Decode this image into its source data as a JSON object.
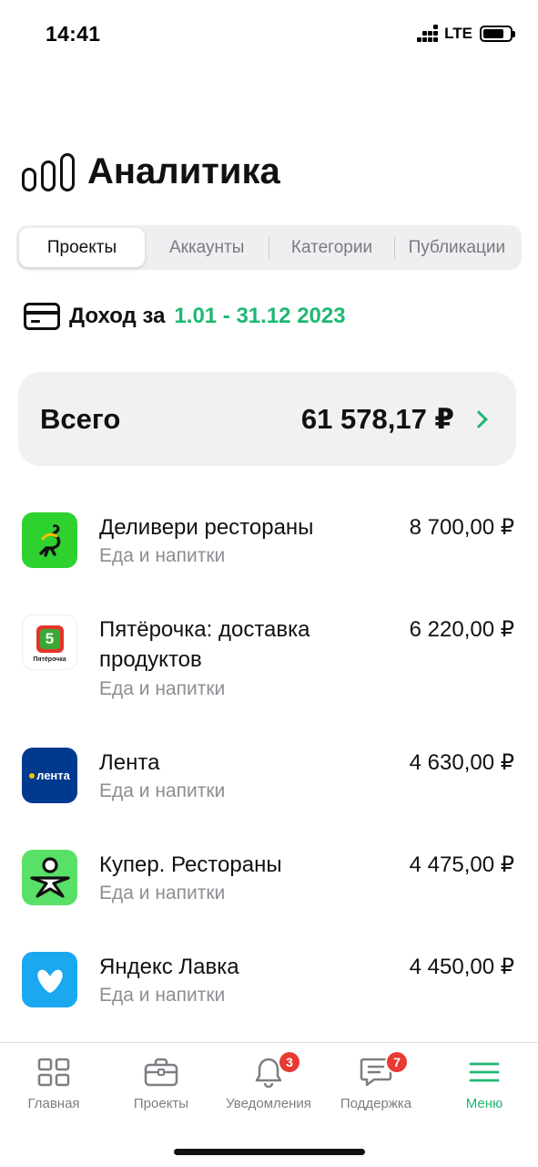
{
  "status": {
    "time": "14:41",
    "network": "LTE"
  },
  "header": {
    "title": "Аналитика",
    "icon": "bar-chart-icon"
  },
  "tabs": [
    {
      "label": "Проекты",
      "active": true
    },
    {
      "label": "Аккаунты",
      "active": false
    },
    {
      "label": "Категории",
      "active": false
    },
    {
      "label": "Публикации",
      "active": false
    }
  ],
  "income": {
    "label": "Доход за",
    "range": "1.01 - 31.12 2023",
    "accent": "#1fb873"
  },
  "total": {
    "label": "Всего",
    "value": "61 578,17 ₽"
  },
  "items": [
    {
      "title": "Деливери рестораны",
      "subtitle": "Еда и напитки",
      "amount": "8 700,00 ₽",
      "icon": "delivery-club-icon"
    },
    {
      "title": "Пятёрочка: доставка продуктов",
      "subtitle": "Еда и напитки",
      "amount": "6 220,00 ₽",
      "icon": "pyaterochka-icon",
      "logo_text": "5",
      "logo_caption": "Пятёрочка"
    },
    {
      "title": "Лента",
      "subtitle": "Еда и напитки",
      "amount": "4 630,00 ₽",
      "icon": "lenta-icon",
      "logo_text": "лента"
    },
    {
      "title": "Купер. Рестораны",
      "subtitle": "Еда и напитки",
      "amount": "4 475,00 ₽",
      "icon": "kuper-icon"
    },
    {
      "title": "Яндекс Лавка",
      "subtitle": "Еда и напитки",
      "amount": "4 450,00 ₽",
      "icon": "yandex-lavka-icon"
    }
  ],
  "tabbar": [
    {
      "label": "Главная",
      "icon": "grid-icon",
      "active": false
    },
    {
      "label": "Проекты",
      "icon": "briefcase-icon",
      "active": false
    },
    {
      "label": "Уведомления",
      "icon": "bell-icon",
      "badge": "3",
      "active": false
    },
    {
      "label": "Поддержка",
      "icon": "chat-icon",
      "badge": "7",
      "active": false
    },
    {
      "label": "Меню",
      "icon": "menu-icon",
      "active": true
    }
  ]
}
